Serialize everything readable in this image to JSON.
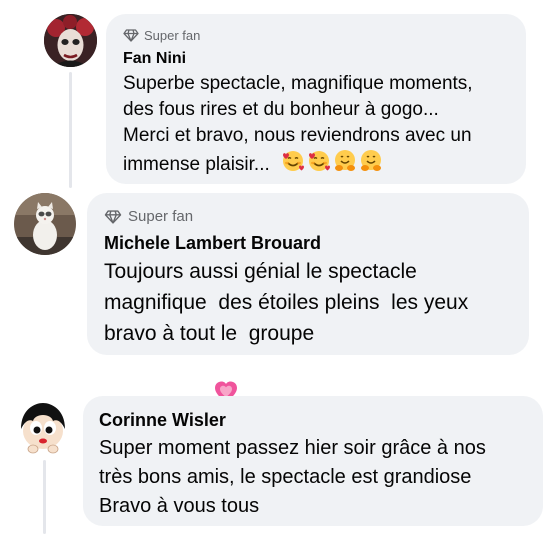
{
  "colors": {
    "bubble": "#f0f2f5",
    "text": "#050505",
    "secondary": "#65676b",
    "thread_line": "#e4e6eb",
    "heart": "#f0549c"
  },
  "comments": [
    {
      "badge_icon": "diamond-icon",
      "badge": "Super fan",
      "author": "Fan Nini",
      "lines": [
        "Superbe spectacle, magnifique moments,",
        "des fous rires et du bonheur à gogo...",
        "Merci et bravo, nous reviendrons avec un",
        "immense plaisir..."
      ],
      "emojis": [
        "smiling-face-with-hearts",
        "smiling-face-with-hearts",
        "hugging-face",
        "hugging-face"
      ]
    },
    {
      "badge_icon": "diamond-icon",
      "badge": "Super fan",
      "author": "Michele Lambert Brouard",
      "lines": [
        "Toujours aussi génial le spectacle",
        "magnifique  des étoiles pleins  les yeux",
        "bravo à tout le  groupe"
      ],
      "emojis": [
        "growing-heart"
      ]
    },
    {
      "author": "Corinne Wisler",
      "lines": [
        "Super moment passez hier soir grâce à nos",
        "très bons amis, le spectacle est grandiose",
        "Bravo à vous tous"
      ]
    }
  ]
}
